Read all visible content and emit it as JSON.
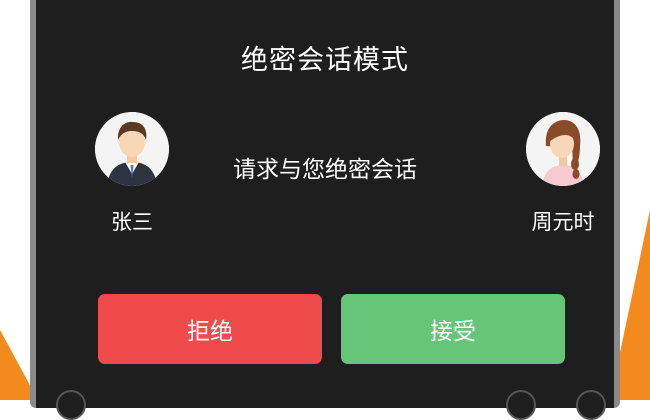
{
  "dialog": {
    "title": "绝密会话模式",
    "request_text": "请求与您绝密会话",
    "caller": {
      "name": "张三",
      "avatar_icon": "male-avatar-icon"
    },
    "callee": {
      "name": "周元时",
      "avatar_icon": "female-avatar-icon"
    },
    "buttons": {
      "reject_label": "拒绝",
      "accept_label": "接受"
    }
  },
  "colors": {
    "dialog_bg": "#1e1e1e",
    "reject": "#ef4b4b",
    "accept": "#67c57a",
    "accent": "#f28a1e"
  }
}
